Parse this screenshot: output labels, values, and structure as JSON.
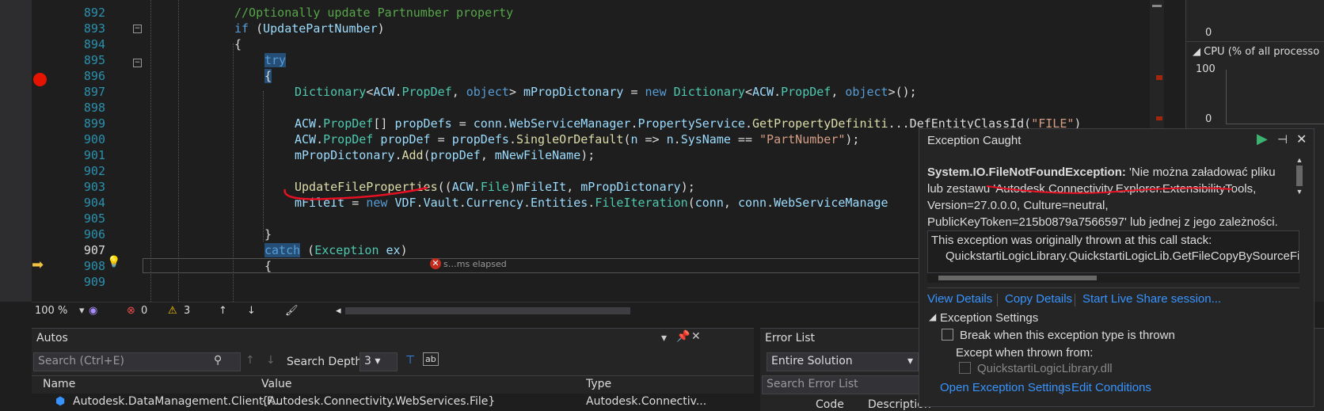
{
  "editor": {
    "lines": [
      {
        "num": "892",
        "segments": [
          [
            "cm",
            "//Optionally update Partnumber property"
          ]
        ]
      },
      {
        "num": "893",
        "segments": [
          [
            "kw",
            "if"
          ],
          [
            "pl",
            " ("
          ],
          [
            "va",
            "UpdatePartNumber"
          ],
          [
            "pl",
            ")"
          ]
        ]
      },
      {
        "num": "894",
        "segments": [
          [
            "pl",
            "{"
          ]
        ]
      },
      {
        "num": "895",
        "segments": [
          [
            "kw hl",
            "try"
          ]
        ]
      },
      {
        "num": "896",
        "segments": [
          [
            "pl hl",
            "{"
          ]
        ]
      },
      {
        "num": "897",
        "segments": [
          [
            "ty",
            "Dictionary"
          ],
          [
            "pl",
            "<"
          ],
          [
            "va",
            "ACW"
          ],
          [
            "pl",
            "."
          ],
          [
            "ty",
            "PropDef"
          ],
          [
            "pl",
            ", "
          ],
          [
            "kw",
            "object"
          ],
          [
            "pl",
            "> "
          ],
          [
            "va",
            "mPropDictonary"
          ],
          [
            "pl",
            " = "
          ],
          [
            "kw",
            "new"
          ],
          [
            "pl",
            " "
          ],
          [
            "ty",
            "Dictionary"
          ],
          [
            "pl",
            "<"
          ],
          [
            "va",
            "ACW"
          ],
          [
            "pl",
            "."
          ],
          [
            "ty",
            "PropDef"
          ],
          [
            "pl",
            ", "
          ],
          [
            "kw",
            "object"
          ],
          [
            "pl",
            ">();"
          ]
        ]
      },
      {
        "num": "898",
        "segments": []
      },
      {
        "num": "899",
        "segments": [
          [
            "va",
            "ACW"
          ],
          [
            "pl",
            "."
          ],
          [
            "ty",
            "PropDef"
          ],
          [
            "pl",
            "[] "
          ],
          [
            "va",
            "propDefs"
          ],
          [
            "pl",
            " = "
          ],
          [
            "va",
            "conn"
          ],
          [
            "pl",
            "."
          ],
          [
            "va",
            "WebServiceManager"
          ],
          [
            "pl",
            "."
          ],
          [
            "va",
            "PropertyService"
          ],
          [
            "pl",
            "."
          ],
          [
            "fn",
            "GetPropertyDefiniti"
          ],
          [
            "pl",
            "...DefEntityClassId("
          ],
          [
            "st",
            "\"FILE\""
          ],
          [
            "pl",
            ")"
          ]
        ]
      },
      {
        "num": "900",
        "segments": [
          [
            "va",
            "ACW"
          ],
          [
            "pl",
            "."
          ],
          [
            "ty",
            "PropDef"
          ],
          [
            "pl",
            " "
          ],
          [
            "va",
            "propDef"
          ],
          [
            "pl",
            " = "
          ],
          [
            "va",
            "propDefs"
          ],
          [
            "pl",
            "."
          ],
          [
            "fn",
            "SingleOrDefault"
          ],
          [
            "pl",
            "("
          ],
          [
            "va",
            "n"
          ],
          [
            "pl",
            " => "
          ],
          [
            "va",
            "n"
          ],
          [
            "pl",
            "."
          ],
          [
            "va",
            "SysName"
          ],
          [
            "pl",
            " == "
          ],
          [
            "st",
            "\"PartNumber\""
          ],
          [
            "pl",
            ");"
          ]
        ]
      },
      {
        "num": "901",
        "segments": [
          [
            "va",
            "mPropDictonary"
          ],
          [
            "pl",
            "."
          ],
          [
            "fn",
            "Add"
          ],
          [
            "pl",
            "("
          ],
          [
            "va",
            "propDef"
          ],
          [
            "pl",
            ", "
          ],
          [
            "va",
            "mNewFileName"
          ],
          [
            "pl",
            ");"
          ]
        ]
      },
      {
        "num": "902",
        "segments": []
      },
      {
        "num": "903",
        "segments": [
          [
            "fn",
            "UpdateFileProperties"
          ],
          [
            "pl",
            "(("
          ],
          [
            "va",
            "ACW"
          ],
          [
            "pl",
            "."
          ],
          [
            "ty",
            "File"
          ],
          [
            "pl",
            ")"
          ],
          [
            "va",
            "mFileIt"
          ],
          [
            "pl",
            ", "
          ],
          [
            "va",
            "mPropDictonary"
          ],
          [
            "pl",
            ");"
          ]
        ]
      },
      {
        "num": "904",
        "segments": [
          [
            "va",
            "mFileIt"
          ],
          [
            "pl",
            " = "
          ],
          [
            "kw",
            "new"
          ],
          [
            "pl",
            " "
          ],
          [
            "va",
            "VDF"
          ],
          [
            "pl",
            "."
          ],
          [
            "va",
            "Vault"
          ],
          [
            "pl",
            "."
          ],
          [
            "va",
            "Currency"
          ],
          [
            "pl",
            "."
          ],
          [
            "va",
            "Entities"
          ],
          [
            "pl",
            "."
          ],
          [
            "ty",
            "FileIteration"
          ],
          [
            "pl",
            "("
          ],
          [
            "va",
            "conn"
          ],
          [
            "pl",
            ", "
          ],
          [
            "va",
            "conn"
          ],
          [
            "pl",
            "."
          ],
          [
            "va",
            "WebServiceManage"
          ]
        ]
      },
      {
        "num": "905",
        "segments": []
      },
      {
        "num": "906",
        "segments": [
          [
            "pl",
            "}"
          ]
        ]
      },
      {
        "num": "907",
        "segments": [
          [
            "kw hl",
            "catch"
          ],
          [
            "pl",
            " ("
          ],
          [
            "ty",
            "Exception"
          ],
          [
            "pl",
            " "
          ],
          [
            "va",
            "ex"
          ],
          [
            "pl",
            ")"
          ]
        ]
      },
      {
        "num": "908",
        "segments": [
          [
            "pl",
            "{"
          ]
        ]
      },
      {
        "num": "909",
        "segments": []
      }
    ],
    "elapsed_text": "s…ms elapsed"
  },
  "statusbar": {
    "zoom": "100 %",
    "errors": "0",
    "warnings": "3"
  },
  "diagnostics": {
    "top_value": "0",
    "cpu_title": "CPU (% of all processo",
    "cpu_max": "100",
    "cpu_min": "0"
  },
  "autos": {
    "title": "Autos",
    "search_placeholder": "Search (Ctrl+E)",
    "depth_label": "Search Depth:",
    "depth_value": "3",
    "columns": [
      "Name",
      "Value",
      "Type"
    ],
    "row": {
      "name": "Autodesk.DataManagement.Client.F...",
      "value": "{Autodesk.Connectivity.WebServices.File}",
      "type": "Autodesk.Connectiv..."
    }
  },
  "errorlist": {
    "title": "Error List",
    "scope": "Entire Solution",
    "search_placeholder": "Search Error List",
    "columns": [
      "Code",
      "Description"
    ]
  },
  "exception": {
    "title": "Exception Caught",
    "type": "System.IO.FileNotFoundException:",
    "message": " 'Nie można załadować pliku lub zestawu 'Autodesk.Connectivity.Explorer.ExtensibilityTools, Version=27.0.0.0, Culture=neutral, PublicKeyToken=215b0879a7566597' lub jednej z jego zależności.",
    "stack_header": "This exception was originally thrown at this call stack:",
    "stack_line": "QuickstartiLogicLibrary.QuickstartiLogicLib.GetFileCopyBySourceFileNa",
    "links": {
      "view": "View Details",
      "copy": "Copy Details",
      "share": "Start Live Share session..."
    },
    "settings_title": "Exception Settings",
    "break_label": "Break when this exception type is thrown",
    "except_label": "Except when thrown from:",
    "dll_label": "QuickstartiLogicLibrary.dll",
    "open_settings": "Open Exception Settings",
    "edit_conditions": "Edit Conditions"
  }
}
